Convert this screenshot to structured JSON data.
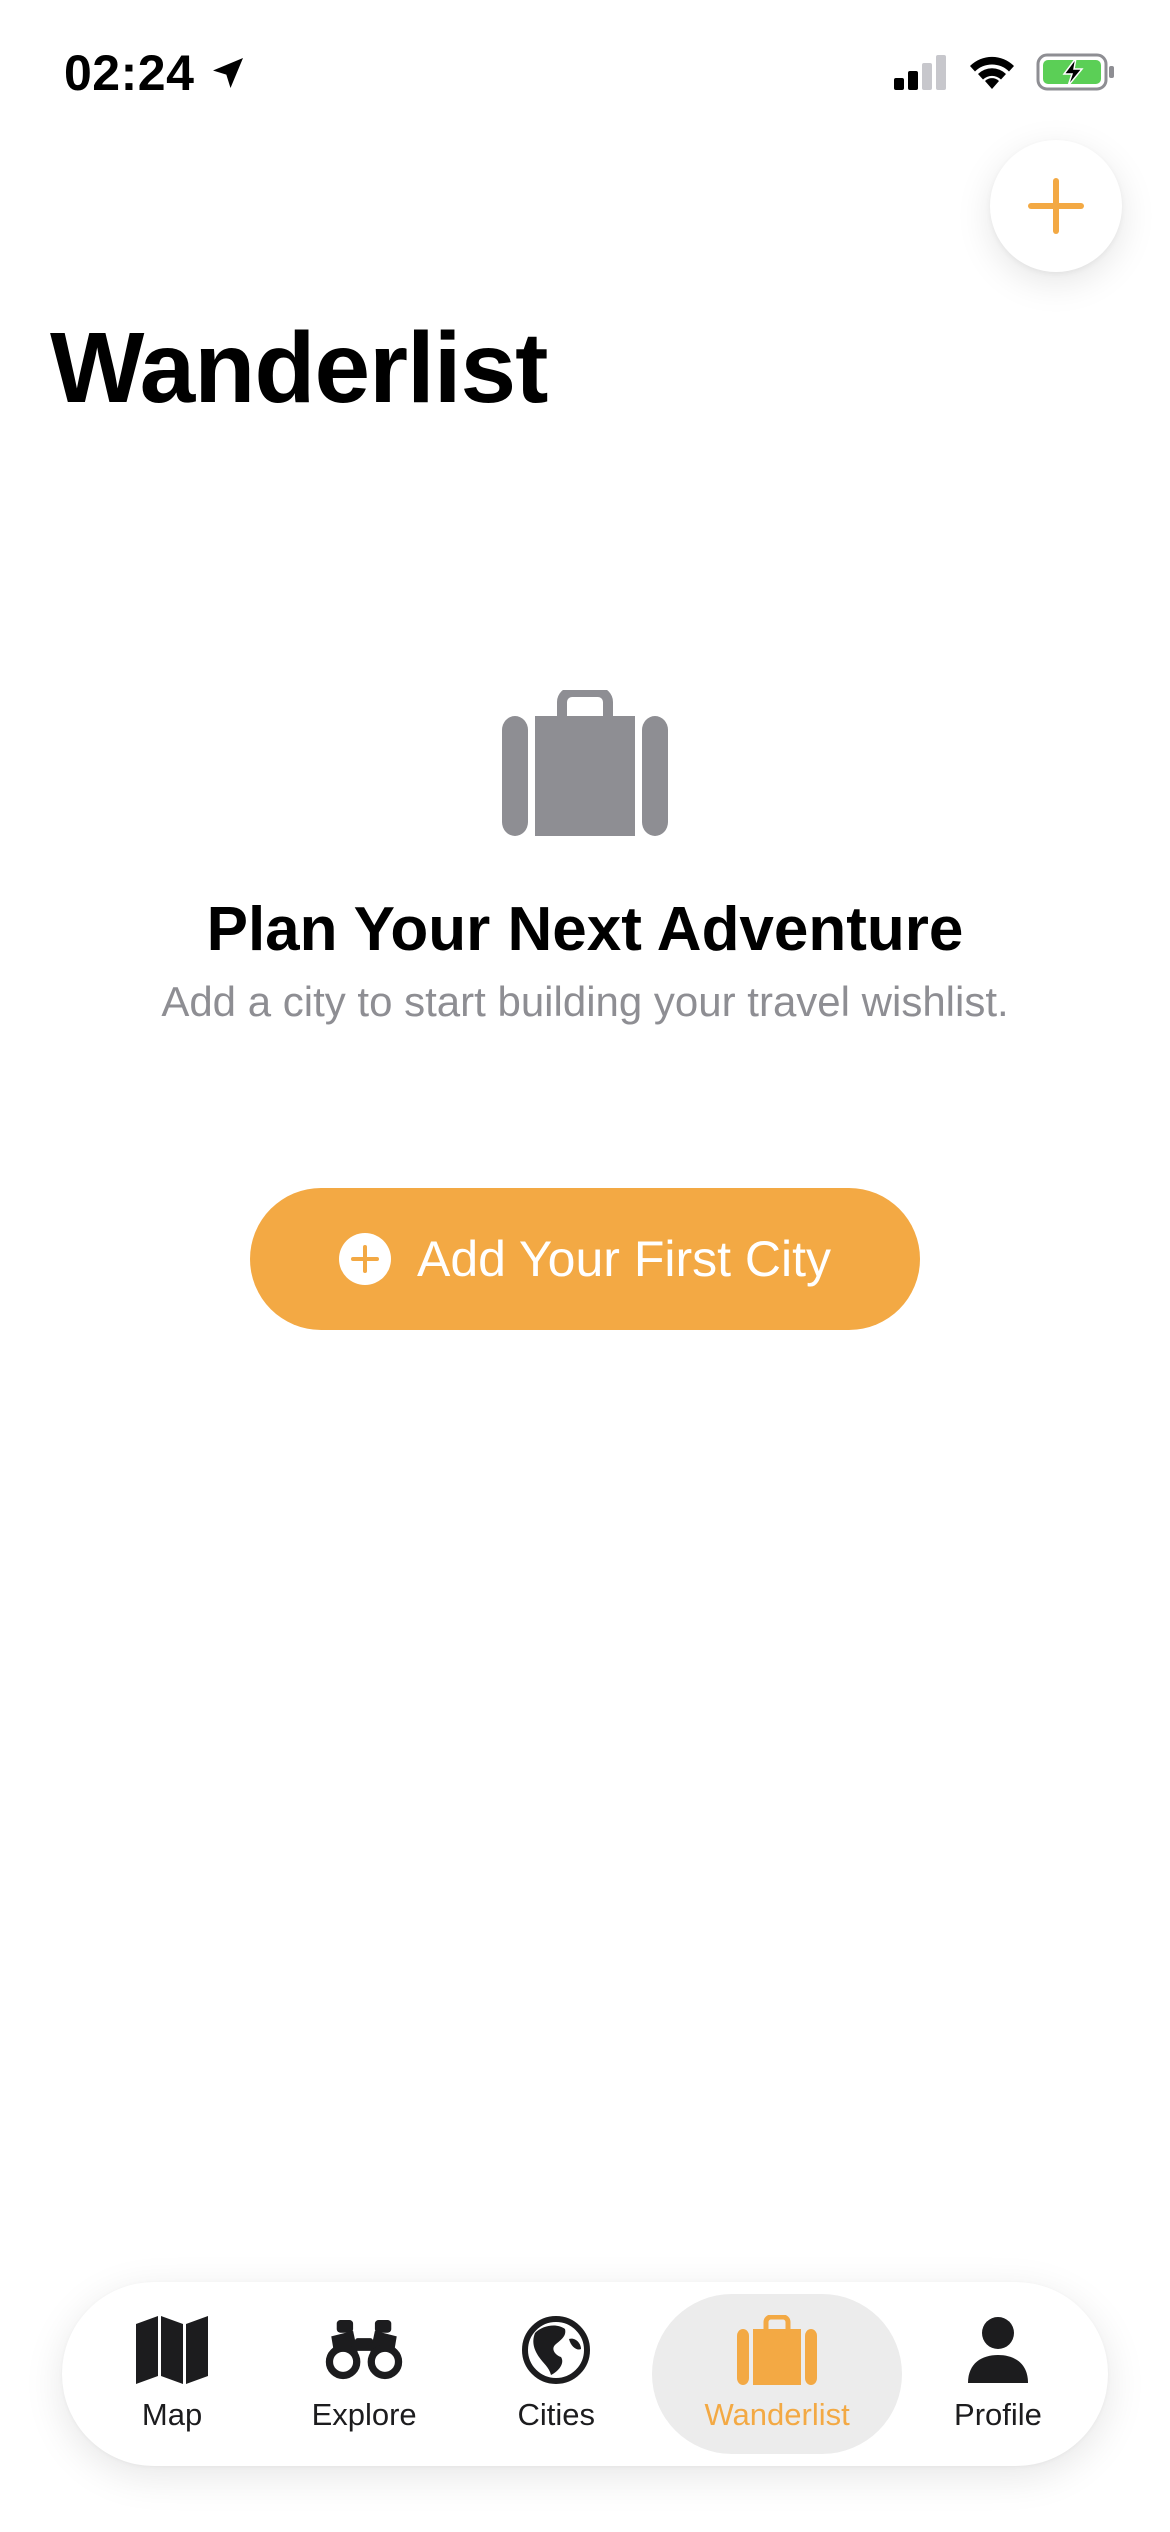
{
  "status_bar": {
    "time": "02:24"
  },
  "header": {
    "title": "Wanderlist"
  },
  "empty_state": {
    "title": "Plan Your Next Adventure",
    "subtitle": "Add a city to start building your travel wishlist.",
    "icon": "suitcase-icon"
  },
  "primary_action": {
    "label": "Add Your First City",
    "icon": "plus-circle-icon"
  },
  "tab_bar": {
    "active": "Wanderlist",
    "items": [
      {
        "label": "Map",
        "icon": "map-icon"
      },
      {
        "label": "Explore",
        "icon": "binoculars-icon"
      },
      {
        "label": "Cities",
        "icon": "globe-icon"
      },
      {
        "label": "Wanderlist",
        "icon": "suitcase-icon"
      },
      {
        "label": "Profile",
        "icon": "person-icon"
      }
    ]
  },
  "colors": {
    "accent": "#f3a944",
    "muted_icon": "#8e8e93",
    "battery_green": "#5bcf56"
  }
}
